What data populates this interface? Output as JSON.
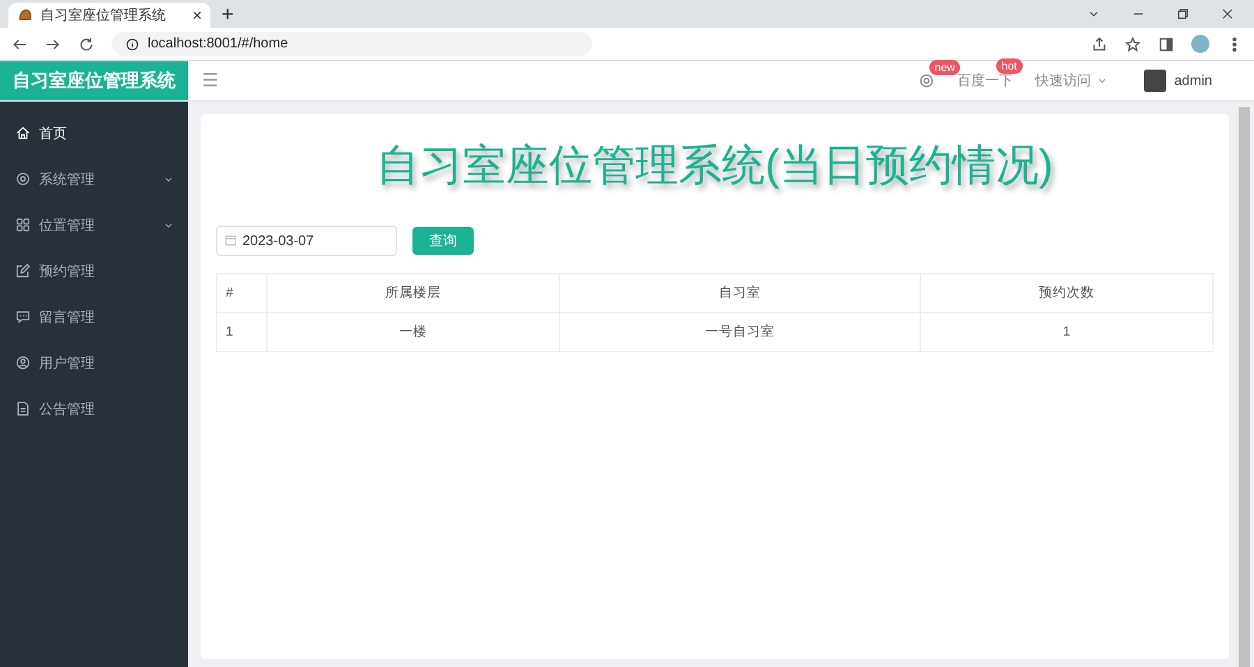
{
  "browser": {
    "tab_title": "自习室座位管理系统",
    "tab_close": "×",
    "new_tab": "+",
    "url": "localhost:8001/#/home"
  },
  "header": {
    "logo": "自习室座位管理系统",
    "menu_glyph": "☰",
    "settings_badge": "new",
    "baidu": {
      "label": "百度一下",
      "badge": "hot"
    },
    "quick_access": "快速访问",
    "user": "admin"
  },
  "sidebar": {
    "items": [
      {
        "label": "首页",
        "kind": "home",
        "expandable": false,
        "selected": true
      },
      {
        "label": "系统管理",
        "kind": "gear",
        "expandable": true,
        "selected": false
      },
      {
        "label": "位置管理",
        "kind": "grid",
        "expandable": true,
        "selected": false
      },
      {
        "label": "预约管理",
        "kind": "edit",
        "expandable": false,
        "selected": false
      },
      {
        "label": "留言管理",
        "kind": "chat",
        "expandable": false,
        "selected": false
      },
      {
        "label": "用户管理",
        "kind": "user",
        "expandable": false,
        "selected": false
      },
      {
        "label": "公告管理",
        "kind": "doc",
        "expandable": false,
        "selected": false
      }
    ]
  },
  "main": {
    "title": "自习室座位管理系统(当日预约情况)",
    "date_filter": {
      "value": "2023-03-07"
    },
    "search_button": "查询",
    "table": {
      "columns": [
        "#",
        "所属楼层",
        "自习室",
        "预约次数"
      ],
      "rows": [
        [
          "1",
          "一楼",
          "一号自习室",
          "1"
        ]
      ]
    }
  }
}
